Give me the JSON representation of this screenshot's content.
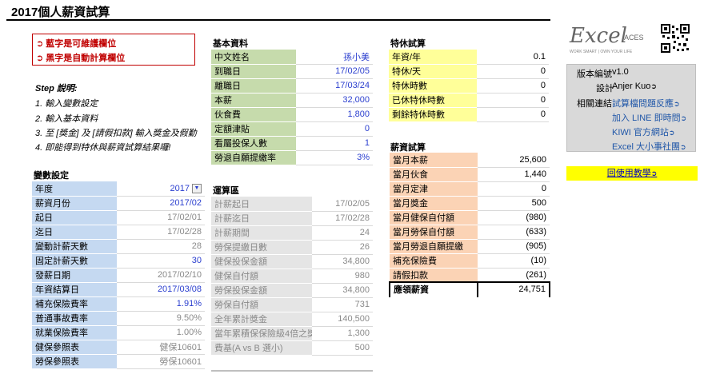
{
  "title": "2017個人薪資試算",
  "legend": {
    "line1": "➲ 藍字是可維護欄位",
    "line2": "➲ 黑字是自動計算欄位"
  },
  "steps": {
    "title": "Step 說明:",
    "items": [
      "1. 輸入變數設定",
      "2. 輸入基本資料",
      "3. 至 [獎金] 及 [請假扣款] 輸入獎金及假勤",
      "4. 即能得到特休與薪資試算結果囉!"
    ]
  },
  "basic": {
    "title": "基本資料",
    "rows": [
      {
        "label": "中文姓名",
        "value": "孫小美"
      },
      {
        "label": "到職日",
        "value": "17/02/05"
      },
      {
        "label": "離職日",
        "value": "17/03/24"
      },
      {
        "label": "本薪",
        "value": "32,000"
      },
      {
        "label": "伙食費",
        "value": "1,800"
      },
      {
        "label": "定額津貼",
        "value": "0"
      },
      {
        "label": "看屬投保人數",
        "value": "1"
      },
      {
        "label": "勞退自願提繳率",
        "value": "3%"
      }
    ]
  },
  "annual": {
    "title": "特休試算",
    "rows": [
      {
        "label": "年資/年",
        "value": "0.1"
      },
      {
        "label": "特休/天",
        "value": "0"
      },
      {
        "label": "特休時數",
        "value": "0"
      },
      {
        "label": "已休特休時數",
        "value": "0"
      },
      {
        "label": "剩餘特休時數",
        "value": "0"
      }
    ]
  },
  "salary": {
    "title": "薪資試算",
    "rows": [
      {
        "label": "當月本薪",
        "value": "25,600"
      },
      {
        "label": "當月伙食",
        "value": "1,440"
      },
      {
        "label": "當月定津",
        "value": "0"
      },
      {
        "label": "當月獎金",
        "value": "500"
      },
      {
        "label": "當月健保自付額",
        "value": "(980)"
      },
      {
        "label": "當月勞保自付額",
        "value": "(633)"
      },
      {
        "label": "當月勞退自願提繳",
        "value": "(905)"
      },
      {
        "label": "補充保險費",
        "value": "(10)"
      },
      {
        "label": "請假扣款",
        "value": "(261)"
      }
    ],
    "final_label": "應領薪資",
    "final_value": "24,751"
  },
  "vars": {
    "title": "變數設定",
    "rows": [
      {
        "label": "年度",
        "value": "2017"
      },
      {
        "label": "薪資月份",
        "value": "2017/02"
      },
      {
        "label": "起日",
        "value": "17/02/01"
      },
      {
        "label": "迄日",
        "value": "17/02/28"
      },
      {
        "label": "變動計薪天數",
        "value": "28"
      },
      {
        "label": "固定計薪天數",
        "value": "30"
      },
      {
        "label": "發薪日期",
        "value": "2017/02/10"
      },
      {
        "label": "年資結算日",
        "value": "2017/03/08"
      },
      {
        "label": "補充保險費率",
        "value": "1.91%"
      },
      {
        "label": "普通事故費率",
        "value": "9.50%"
      },
      {
        "label": "就業保險費率",
        "value": "1.00%"
      },
      {
        "label": "健保參照表",
        "value": "健保10601"
      },
      {
        "label": "勞保參照表",
        "value": "勞保10601"
      }
    ]
  },
  "calc": {
    "title": "運算區",
    "rows": [
      {
        "label": "計薪起日",
        "value": "17/02/05"
      },
      {
        "label": "計薪迄日",
        "value": "17/02/28"
      },
      {
        "label": "計薪期間",
        "value": "24"
      },
      {
        "label": "勞保提繳日數",
        "value": "26"
      },
      {
        "label": "健保投保金額",
        "value": "34,800"
      },
      {
        "label": "健保自付額",
        "value": "980"
      },
      {
        "label": "勞保投保金額",
        "value": "34,800"
      },
      {
        "label": "勞保自付額",
        "value": "731"
      },
      {
        "label": "全年累計獎金",
        "value": "140,500"
      },
      {
        "label": "當年累積保保險級4倍之獎金(B)",
        "value": "1,300"
      },
      {
        "label": "費基(A vs B 選小)",
        "value": "500"
      }
    ]
  },
  "logo": {
    "main": "Excel",
    "aces": "ACES",
    "tagline": "WORK SMART | OWN YOUR LIFE"
  },
  "info": {
    "version_label": "版本編號",
    "version_value": "v1.0",
    "design_label": "設計",
    "design_value": "Anjer Kuo",
    "links_label": "相關連結",
    "links": [
      "試算檔問題反應",
      "加入 LINE 即時問",
      "KIWI 官方網站",
      "Excel 大小事社團"
    ]
  },
  "tutorial_link": "回使用教學",
  "colors": {
    "green": "#c6dbac",
    "yellow": "#ffff99",
    "blue": "#c5d9f1",
    "gray": "#e5e5e5",
    "orange": "#fbd3b5",
    "blue_text": "#2b3fcf",
    "legend_red": "#c00000"
  },
  "icons": {
    "dropdown": "chevron-down-icon",
    "arrow": "arrow-right-icon",
    "qr": "qr-code-icon"
  }
}
